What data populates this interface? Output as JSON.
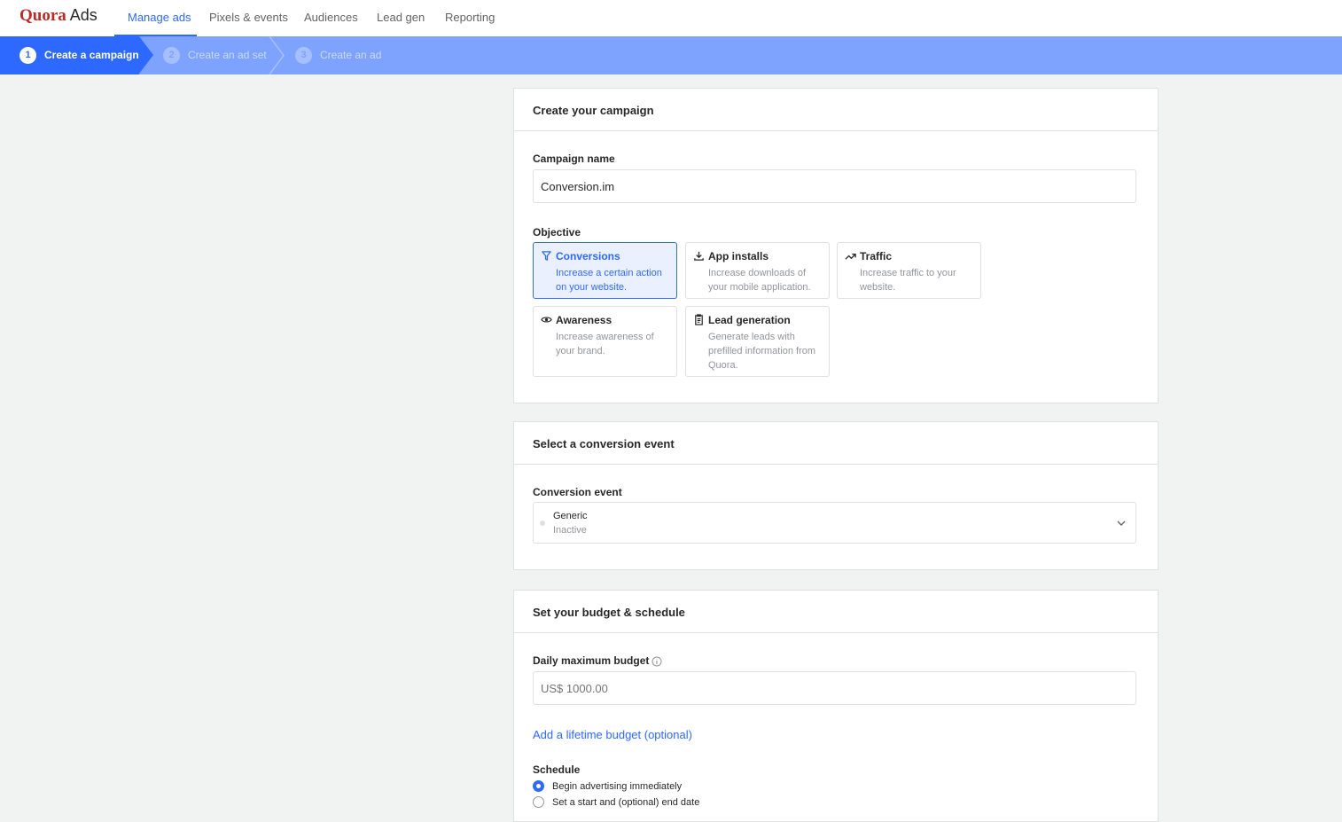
{
  "brand": {
    "name": "Quora",
    "product": "Ads"
  },
  "nav": {
    "items": [
      {
        "label": "Manage ads",
        "active": true
      },
      {
        "label": "Pixels & events"
      },
      {
        "label": "Audiences"
      },
      {
        "label": "Lead gen"
      },
      {
        "label": "Reporting"
      }
    ]
  },
  "steps": [
    {
      "number": "1",
      "label": "Create a campaign",
      "active": true
    },
    {
      "number": "2",
      "label": "Create an ad set"
    },
    {
      "number": "3",
      "label": "Create an ad"
    }
  ],
  "campaign": {
    "title": "Create your campaign",
    "name_label": "Campaign name",
    "name_value": "Conversion.im",
    "objective_label": "Objective",
    "objectives": [
      {
        "icon": "funnel-icon",
        "title": "Conversions",
        "desc": "Increase a certain action on your website.",
        "selected": true
      },
      {
        "icon": "download-icon",
        "title": "App installs",
        "desc": "Increase downloads of your mobile application."
      },
      {
        "icon": "trending-up-icon",
        "title": "Traffic",
        "desc": "Increase traffic to your website."
      },
      {
        "icon": "eye-icon",
        "title": "Awareness",
        "desc": "Increase awareness of your brand."
      },
      {
        "icon": "clipboard-icon",
        "title": "Lead generation",
        "desc": "Generate leads with prefilled information from Quora."
      }
    ]
  },
  "conversion": {
    "title": "Select a conversion event",
    "event_label": "Conversion event",
    "selected_event": "Generic",
    "selected_status": "Inactive"
  },
  "budget": {
    "title": "Set your budget & schedule",
    "daily_label": "Daily maximum budget",
    "daily_placeholder": "US$ 1000.00",
    "lifetime_link": "Add a lifetime budget (optional)",
    "schedule_label": "Schedule",
    "schedule_options": [
      {
        "label": "Begin advertising immediately",
        "selected": true
      },
      {
        "label": "Set a start and (optional) end date"
      }
    ]
  },
  "colors": {
    "accent": "#2e69ff",
    "brand": "#b92b27",
    "step_bar": "#7ea3ff"
  }
}
